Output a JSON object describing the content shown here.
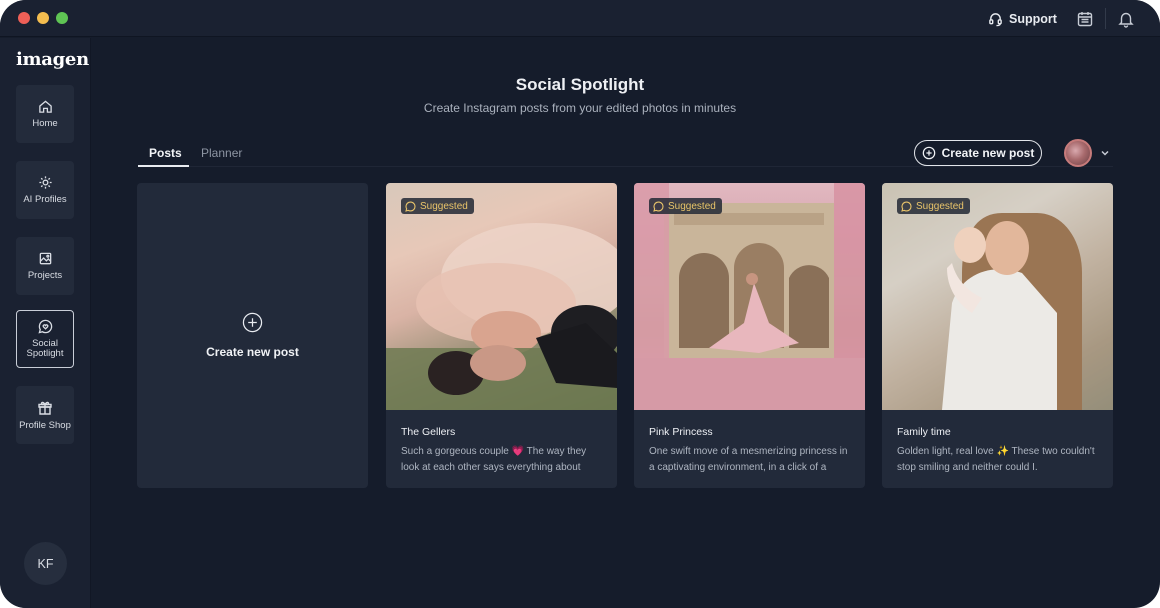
{
  "app": {
    "logo_text": "imagen",
    "user_initials": "KF",
    "support_label": "Support"
  },
  "sidebar": {
    "items": [
      {
        "label": "Home",
        "icon": "home-icon",
        "active": false
      },
      {
        "label": "AI Profiles",
        "icon": "ai-profiles-icon",
        "active": false
      },
      {
        "label": "Projects",
        "icon": "projects-icon",
        "active": false
      },
      {
        "label": "Social Spotlight",
        "icon": "social-spotlight-icon",
        "active": true
      },
      {
        "label": "Profile Shop",
        "icon": "profile-shop-icon",
        "active": false
      }
    ]
  },
  "page": {
    "title": "Social Spotlight",
    "subtitle": "Create Instagram posts from your edited photos in minutes"
  },
  "tabs": [
    {
      "label": "Posts",
      "active": true
    },
    {
      "label": "Planner",
      "active": false
    }
  ],
  "actions": {
    "create_post_label": "Create new post"
  },
  "new_post_card": {
    "label": "Create new post"
  },
  "posts": [
    {
      "badge": "Suggested",
      "title": "The Gellers",
      "description": "Such a gorgeous couple 💗 The way they look at each other says everything about",
      "image": "couple-lying-in-grass-photo"
    },
    {
      "badge": "Suggested",
      "title": "Pink Princess",
      "description": "One swift move of a mesmerizing princess in a captivating environment, in a click of a",
      "image": "woman-pink-gown-arches-photo"
    },
    {
      "badge": "Suggested",
      "title": "Family time",
      "description": "Golden light, real love ✨ These two couldn't stop smiling and neither could I.",
      "image": "mother-holding-baby-photo"
    }
  ],
  "colors": {
    "background": "#151c2b",
    "sidebar": "#1a2131",
    "card": "#222a3a",
    "badge_text": "#e9c46a",
    "active_border": "#c9ced8"
  }
}
